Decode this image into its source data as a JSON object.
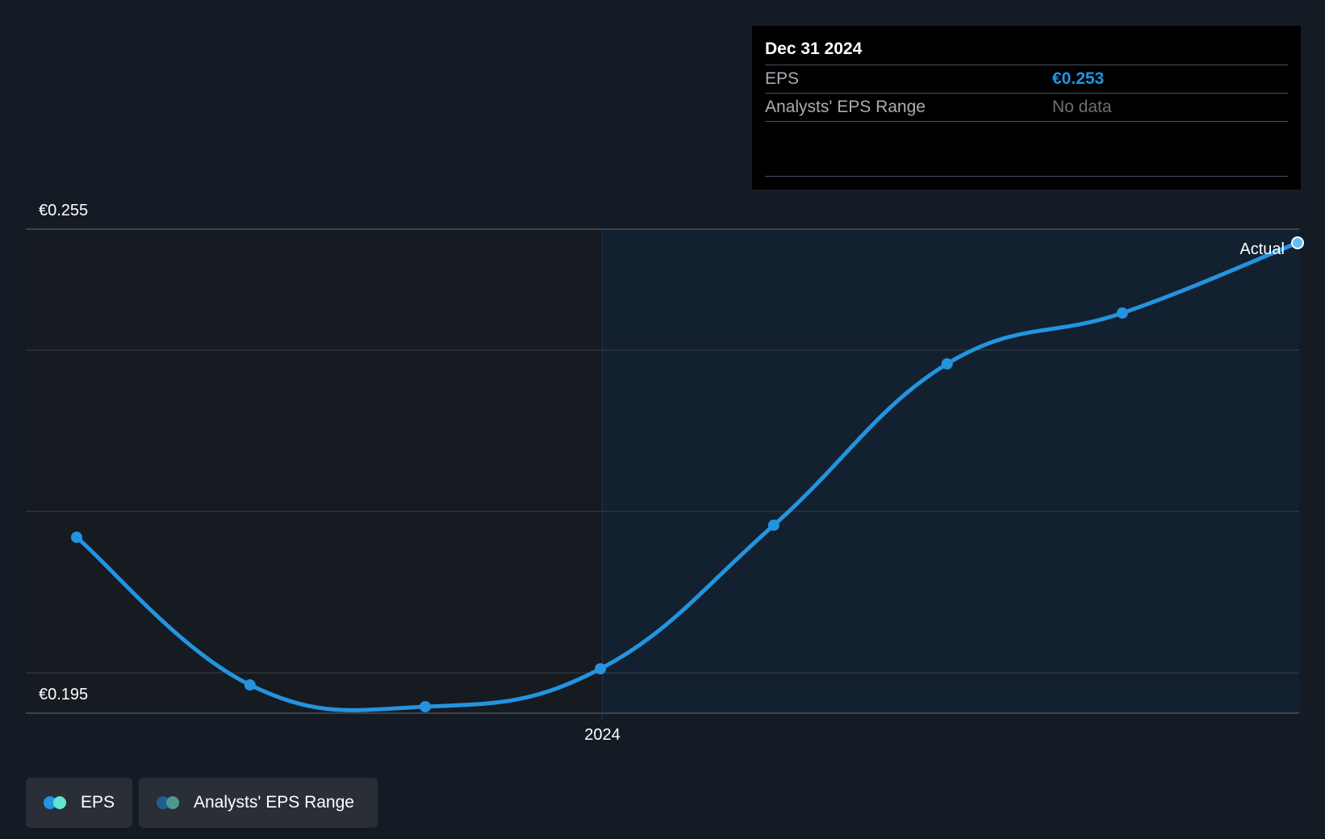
{
  "colors": {
    "background": "#151b24",
    "past_region": "#161a21",
    "future_region": "#13202f",
    "eps_line": "#2394df",
    "grid": "#3a4048",
    "tooltip_bg": "#000000",
    "eps_legend_a": "#2394df",
    "eps_legend_b": "#5ee6d0",
    "range_legend_a": "#1f5f8f",
    "range_legend_b": "#4a9a94"
  },
  "tooltip": {
    "date": "Dec 31 2024",
    "rows": [
      {
        "label": "EPS",
        "value": "€0.253"
      },
      {
        "label": "Analysts' EPS Range",
        "value": "No data"
      }
    ]
  },
  "legend": {
    "eps_label": "EPS",
    "range_label": "Analysts' EPS Range"
  },
  "chart_data": {
    "type": "line",
    "title": "",
    "xlabel": "",
    "ylabel": "",
    "y_tick_labels": [
      "€0.255",
      "€0.195"
    ],
    "x_tick_labels": [
      "2024"
    ],
    "ylim": [
      0.195,
      0.255
    ],
    "xlim": [
      "2023-03-31",
      "2024-12-31"
    ],
    "series": [
      {
        "name": "EPS",
        "x": [
          "2023-03-31",
          "2023-06-30",
          "2023-09-30",
          "2023-12-31",
          "2024-03-31",
          "2024-06-30",
          "2024-09-30",
          "2024-12-31"
        ],
        "values": [
          0.2168,
          0.1985,
          0.1958,
          0.2005,
          0.2183,
          0.2383,
          0.2446,
          0.2533
        ]
      }
    ],
    "annotations": [
      "Actual"
    ],
    "grid": true,
    "legend": "bottom-left"
  }
}
